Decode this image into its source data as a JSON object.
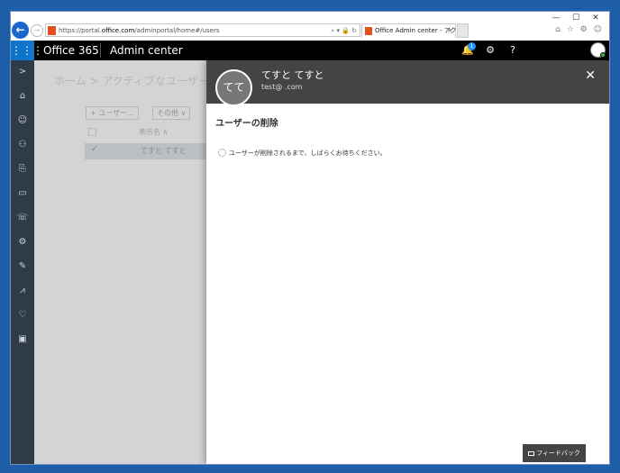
{
  "browser": {
    "url_prefix": "https://portal.",
    "url_domain": "office.com",
    "url_path": "/adminportal/home#/users",
    "url_tools": "⌕ ▾ 🔒 ↻",
    "tab_title": "Office Admin center - アクテ...",
    "tab_close": "×",
    "right_icons": "⌂ ☆ ⚙ ☺",
    "win_min": "—",
    "win_max": "☐",
    "win_close": "✕",
    "back_glyph": "←",
    "fwd_glyph": "→"
  },
  "topbar": {
    "waffle_glyph": "⋮⋮⋮",
    "brand": "Office 365",
    "title": "Admin center",
    "notification_count": "1",
    "bell_glyph": "🔔",
    "gear_glyph": "⚙",
    "help_glyph": "?"
  },
  "rail": {
    "icons": [
      "chevron-right-icon",
      "home-icon",
      "user-icon",
      "groups-icon",
      "resources-icon",
      "billing-icon",
      "support-icon",
      "settings-icon",
      "setup-icon",
      "reports-icon",
      "health-icon",
      "admin-centers-icon"
    ],
    "glyphs": [
      ">",
      "⌂",
      "☺",
      "⚇",
      "⎘",
      "▭",
      "☏",
      "⚙",
      "✎",
      "⩘",
      "♡",
      "▣"
    ]
  },
  "page": {
    "breadcrumb": "ホーム > アクティブなユーザー",
    "add_user": "+ ユーザー...",
    "other": "その他 ∨",
    "col_display_name": "表示名 ∧",
    "row_name": "てすと てすと",
    "row_check": "✓"
  },
  "panel": {
    "initials": "てて",
    "name": "てすと てすと",
    "email": "test@            .com",
    "close_glyph": "✕",
    "section_title": "ユーザーの削除",
    "status": "ユーザーが削除されるまで、しばらくお待ちください。",
    "feedback": "フィードバック"
  }
}
